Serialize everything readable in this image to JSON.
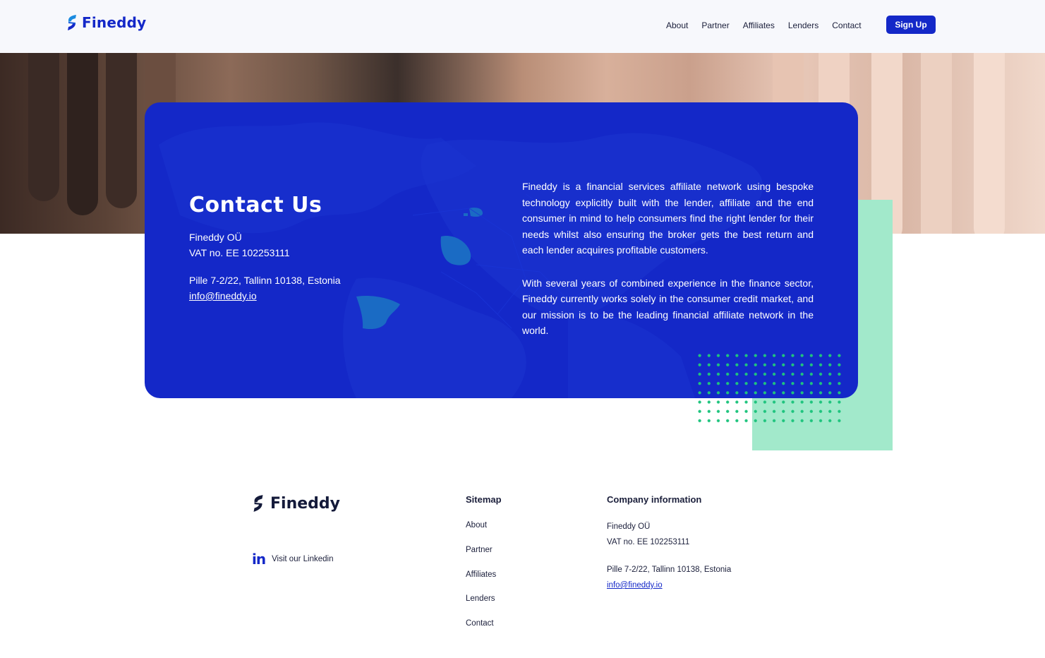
{
  "header": {
    "brand": "Fineddy",
    "nav": [
      "About",
      "Partner",
      "Affiliates",
      "Lenders",
      "Contact"
    ],
    "signup_label": "Sign Up"
  },
  "contact": {
    "title": "Contact Us",
    "company_name": "Fineddy OÜ",
    "vat": "VAT no. EE 102253111",
    "address": "Pille 7-2/22, Tallinn 10138, Estonia",
    "email": "info@fineddy.io",
    "paragraphs": [
      "Fineddy is a financial services affiliate network using bespoke technology explicitly built with the lender, affiliate and the end consumer in mind to help consumers find the right lender for their needs whilst also ensuring the broker gets the best return and each lender acquires profitable customers.",
      "With several years of combined experience in the finance sector, Fineddy currently works solely in the consumer credit market, and our mission is to be the leading financial affiliate network in the world."
    ]
  },
  "footer": {
    "brand": "Fineddy",
    "linkedin_label": "Visit our Linkedin",
    "sitemap_title": "Sitemap",
    "sitemap_links": [
      "About",
      "Partner",
      "Affiliates",
      "Lenders",
      "Contact"
    ],
    "company_title": "Company information",
    "company_name": "Fineddy OÜ",
    "vat": "VAT no. EE 102253111",
    "address": "Pille 7-2/22, Tallinn 10138, Estonia",
    "email": "info@fineddy.io"
  },
  "colors": {
    "brand_blue": "#1428c8",
    "mint": "#a2e9cb",
    "dot_green": "#1fc47e"
  },
  "icons": [
    "fineddy-logo-icon",
    "linkedin-icon"
  ]
}
